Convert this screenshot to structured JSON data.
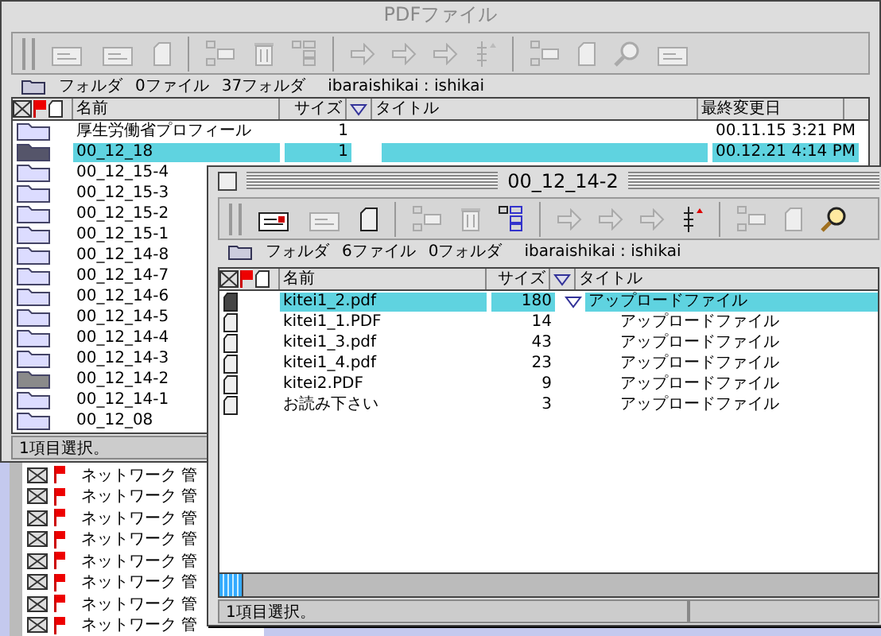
{
  "back_window": {
    "rows": [
      {
        "name": "ネットワーク 管"
      },
      {
        "name": "ネットワーク 管"
      },
      {
        "name": "ネットワーク 管"
      },
      {
        "name": "ネットワーク 管"
      },
      {
        "name": "ネットワーク 管"
      },
      {
        "name": "ネットワーク 管"
      },
      {
        "name": "ネットワーク 管"
      },
      {
        "name": "ネットワーク 管"
      }
    ]
  },
  "main_window": {
    "title": "PDFファイル",
    "info": {
      "label": "フォルダ",
      "files": "0ファイル",
      "folders": "37フォルダ",
      "path": "ibaraishikai : ishikai"
    },
    "columns": {
      "name": "名前",
      "size": "サイズ",
      "title": "タイトル",
      "modified": "最終変更日"
    },
    "rows": [
      {
        "name": "厚生労働省プロフィール",
        "size": "1",
        "modified": "00.11.15  3:21 PM",
        "selected": false,
        "open": false
      },
      {
        "name": "00_12_18",
        "size": "1",
        "modified": "00.12.21  4:14 PM",
        "selected": true,
        "open": false
      },
      {
        "name": "00_12_15-4",
        "selected": false,
        "open": false
      },
      {
        "name": "00_12_15-3",
        "selected": false,
        "open": false
      },
      {
        "name": "00_12_15-2",
        "selected": false,
        "open": false
      },
      {
        "name": "00_12_15-1",
        "selected": false,
        "open": false
      },
      {
        "name": "00_12_14-8",
        "selected": false,
        "open": false
      },
      {
        "name": "00_12_14-7",
        "selected": false,
        "open": false
      },
      {
        "name": "00_12_14-6",
        "selected": false,
        "open": false
      },
      {
        "name": "00_12_14-5",
        "selected": false,
        "open": false
      },
      {
        "name": "00_12_14-4",
        "selected": false,
        "open": false
      },
      {
        "name": "00_12_14-3",
        "selected": false,
        "open": false
      },
      {
        "name": "00_12_14-2",
        "selected": false,
        "open": true
      },
      {
        "name": "00_12_14-1",
        "selected": false,
        "open": false
      },
      {
        "name": "00_12_08",
        "selected": false,
        "open": false
      }
    ],
    "status": "1項目選択。"
  },
  "front_window": {
    "title": "00_12_14-2",
    "info": {
      "label": "フォルダ",
      "files": "6ファイル",
      "folders": "0フォルダ",
      "path": "ibaraishikai : ishikai"
    },
    "columns": {
      "name": "名前",
      "size": "サイズ",
      "title": "タイトル"
    },
    "rows": [
      {
        "name": "kitei1_2.pdf",
        "size": "180",
        "title": "アップロードファイル",
        "selected": true
      },
      {
        "name": "kitei1_1.PDF",
        "size": "14",
        "title": "アップロードファイル",
        "selected": false
      },
      {
        "name": "kitei1_3.pdf",
        "size": "43",
        "title": "アップロードファイル",
        "selected": false
      },
      {
        "name": "kitei1_4.pdf",
        "size": "23",
        "title": "アップロードファイル",
        "selected": false
      },
      {
        "name": "kitei2.PDF",
        "size": "9",
        "title": "アップロードファイル",
        "selected": false
      },
      {
        "name": "お読み下さい",
        "size": "3",
        "title": "アップロードファイル",
        "selected": false
      }
    ],
    "status": "1項目選択。"
  }
}
